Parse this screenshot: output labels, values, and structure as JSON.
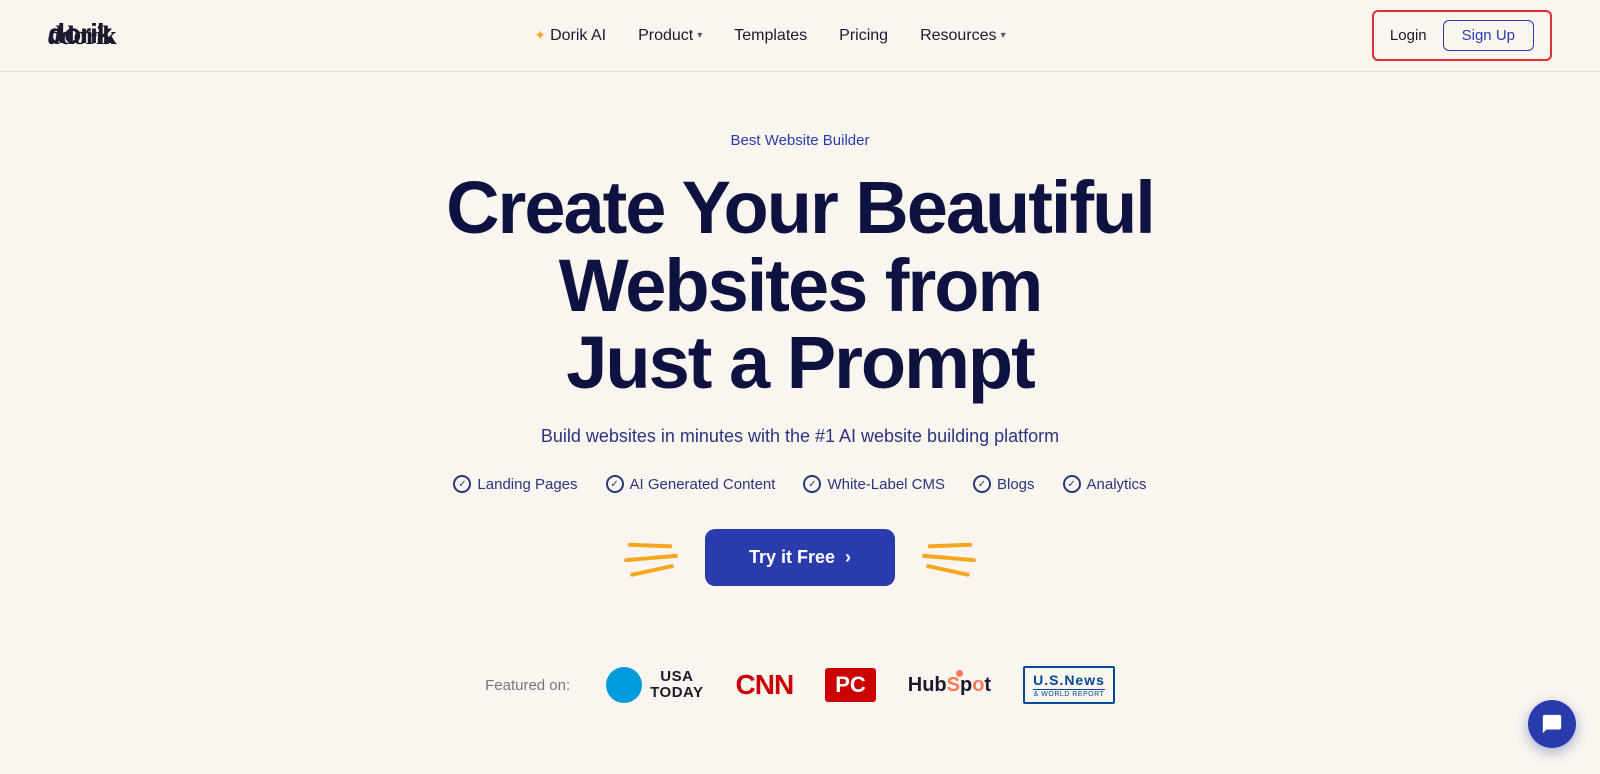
{
  "logo": {
    "text": "dorik"
  },
  "nav": {
    "ai_label": "Dorik AI",
    "ai_star": "✦",
    "product_label": "Product",
    "templates_label": "Templates",
    "pricing_label": "Pricing",
    "resources_label": "Resources",
    "login_label": "Login",
    "signup_label": "Sign Up"
  },
  "hero": {
    "tag": "Best Website Builder",
    "title_line1": "Create Your Beautiful Websites from",
    "title_line2": "Just a Prompt",
    "subtitle": "Build websites in minutes with the #1 AI website building platform",
    "features": [
      "Landing Pages",
      "AI Generated Content",
      "White-Label CMS",
      "Blogs",
      "Analytics"
    ],
    "cta_label": "Try it Free",
    "cta_arrow": "›"
  },
  "featured": {
    "label": "Featured on:",
    "logos": [
      {
        "id": "usa-today",
        "name": "USA TODAY"
      },
      {
        "id": "cnn",
        "name": "CNN"
      },
      {
        "id": "pc",
        "name": "PC"
      },
      {
        "id": "hubspot",
        "name": "HubSpot"
      },
      {
        "id": "usnews",
        "name": "U.S.News"
      }
    ]
  },
  "chat": {
    "label": "chat-button"
  }
}
